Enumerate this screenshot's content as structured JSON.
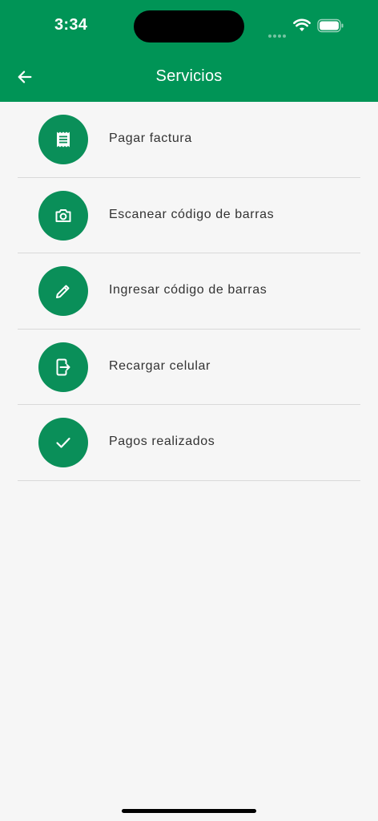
{
  "status_bar": {
    "time": "3:34"
  },
  "app_bar": {
    "title": "Servicios"
  },
  "services": [
    {
      "label": "Pagar factura",
      "icon": "receipt-icon"
    },
    {
      "label": "Escanear código de barras",
      "icon": "camera-icon"
    },
    {
      "label": "Ingresar código de barras",
      "icon": "pencil-icon"
    },
    {
      "label": "Recargar celular",
      "icon": "phone-recharge-icon"
    },
    {
      "label": "Pagos realizados",
      "icon": "check-icon"
    }
  ],
  "colors": {
    "primary": "#009456",
    "icon_circle": "#0a8f59",
    "background": "#f6f6f6"
  }
}
